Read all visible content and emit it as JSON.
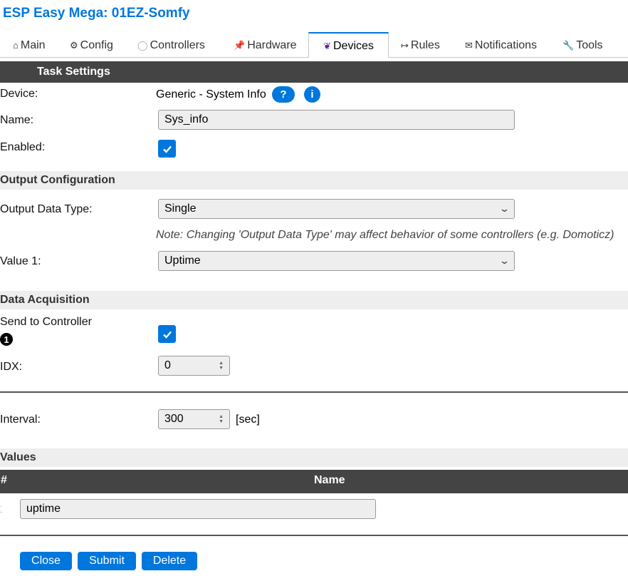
{
  "app": {
    "title": "ESP Easy Mega: 01EZ-Somfy"
  },
  "tabs": [
    {
      "icon": "⌂",
      "label": "Main"
    },
    {
      "icon": "⚙",
      "label": "Config"
    },
    {
      "icon": "◯",
      "label": "Controllers"
    },
    {
      "icon": "📌",
      "label": "Hardware"
    },
    {
      "icon": "❦",
      "label": "Devices"
    },
    {
      "icon": "↦",
      "label": "Rules"
    },
    {
      "icon": "✉",
      "label": "Notifications"
    },
    {
      "icon": "🔧",
      "label": "Tools"
    }
  ],
  "active_tab": "Devices",
  "task_settings": {
    "header": "Task Settings",
    "device_label": "Device:",
    "device_value": "Generic - System Info",
    "help_icon": "?",
    "info_icon": "i",
    "name_label": "Name:",
    "name_value": "Sys_info",
    "enabled_label": "Enabled:",
    "enabled": true
  },
  "output_config": {
    "header": "Output Configuration",
    "data_type_label": "Output Data Type:",
    "data_type_value": "Single",
    "note": "Note: Changing 'Output Data Type' may affect behavior of some controllers (e.g. Domoticz)",
    "value1_label": "Value 1:",
    "value1_value": "Uptime"
  },
  "data_acquisition": {
    "header": "Data Acquisition",
    "send_label": "Send to Controller",
    "send_badge": "1",
    "send_enabled": true,
    "idx_label": "IDX:",
    "idx_value": "0",
    "interval_label": "Interval:",
    "interval_value": "300",
    "interval_unit": "[sec]"
  },
  "values": {
    "header": "Values",
    "col_num": "#",
    "col_name": "Name",
    "rows": [
      {
        "num": "1",
        "name": "uptime"
      }
    ]
  },
  "buttons": {
    "close": "Close",
    "submit": "Submit",
    "delete": "Delete"
  },
  "colors": {
    "accent": "#0077dd",
    "header_dark": "#444444",
    "section_light": "#eeeeee"
  }
}
